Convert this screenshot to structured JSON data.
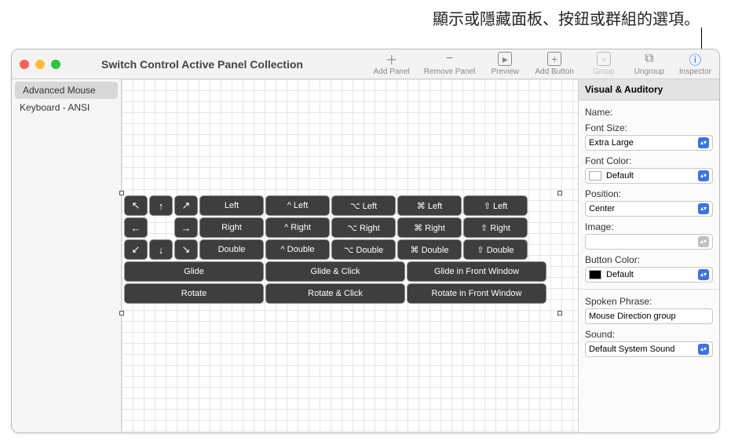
{
  "callout": "顯示或隱藏面板、按鈕或群組的選項。",
  "title": "Switch Control Active Panel Collection",
  "toolbar": {
    "add_panel": "Add Panel",
    "remove_panel": "Remove Panel",
    "preview": "Preview",
    "add_button": "Add Button",
    "group": "Group",
    "ungroup": "Ungroup",
    "inspector": "Inspector"
  },
  "sidebar": {
    "items": [
      "Advanced Mouse",
      "Keyboard - ANSI"
    ]
  },
  "panel": {
    "arrows": {
      "r0": [
        "↖",
        "↑",
        "↗"
      ],
      "r1": [
        "←",
        "",
        "→"
      ],
      "r2": [
        "↙",
        "↓",
        "↘"
      ]
    },
    "row0": [
      "Left",
      "^ Left",
      "⌥ Left",
      "⌘ Left",
      "⇧ Left"
    ],
    "row1": [
      "Right",
      "^ Right",
      "⌥ Right",
      "⌘ Right",
      "⇧ Right"
    ],
    "row2": [
      "Double",
      "^ Double",
      "⌥ Double",
      "⌘ Double",
      "⇧ Double"
    ],
    "row3": [
      "Glide",
      "Glide & Click",
      "Glide in Front Window"
    ],
    "row4": [
      "Rotate",
      "Rotate & Click",
      "Rotate in Front Window"
    ]
  },
  "inspector": {
    "header": "Visual & Auditory",
    "name_label": "Name:",
    "font_size_label": "Font Size:",
    "font_size": "Extra Large",
    "font_color_label": "Font Color:",
    "font_color": "Default",
    "position_label": "Position:",
    "position": "Center",
    "image_label": "Image:",
    "image": "",
    "button_color_label": "Button Color:",
    "button_color": "Default",
    "spoken_label": "Spoken Phrase:",
    "spoken": "Mouse Direction group",
    "sound_label": "Sound:",
    "sound": "Default System Sound"
  }
}
